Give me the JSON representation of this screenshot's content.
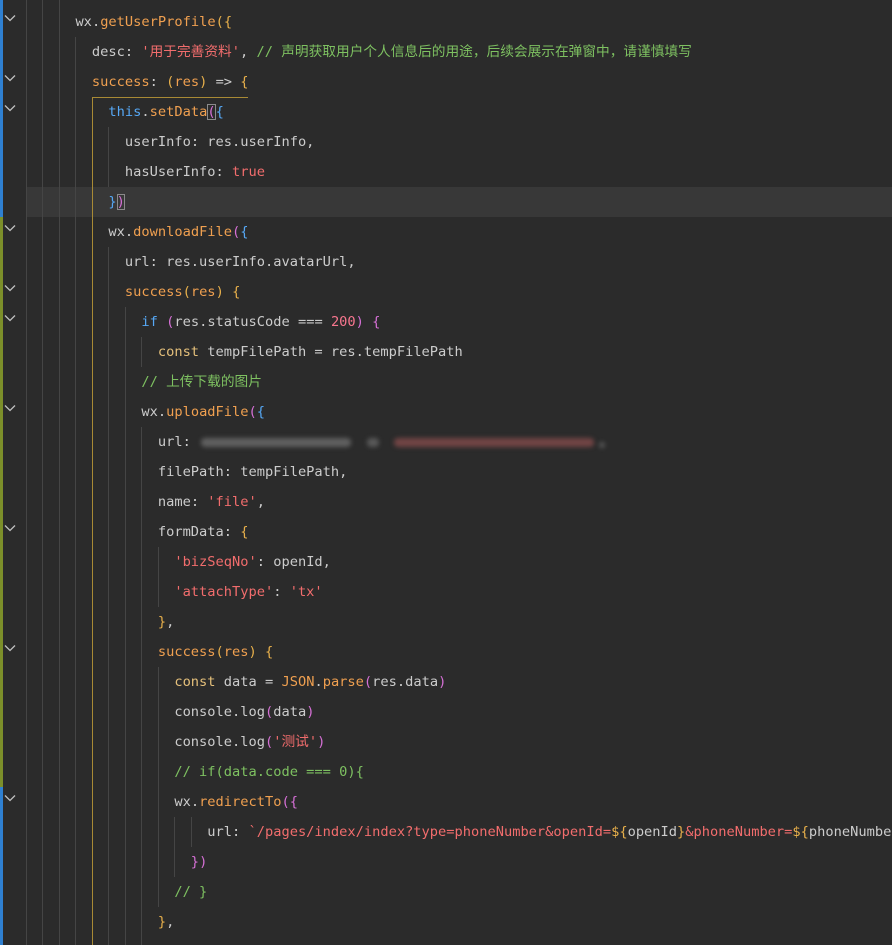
{
  "theme": {
    "background": "#2b2b2b",
    "current_line": "#383838",
    "indent_guide": "#454545",
    "active_guide": "#a88a35",
    "fold_icon": "#c0c0c0",
    "bracket_box": "#8a8a8a"
  },
  "editor": {
    "lines": [
      {
        "foldable": true,
        "change": "#2f80d1",
        "tokens": [
          [
            "      wx",
            "#cccccc"
          ],
          [
            ".",
            "#cccccc"
          ],
          [
            "getUserProfile",
            "#f0a050"
          ],
          [
            "(",
            "#e8b04b"
          ],
          [
            "{",
            "#e8b04b"
          ]
        ]
      },
      {
        "change": "#2f80d1",
        "tokens": [
          [
            "        desc",
            "#cccccc"
          ],
          [
            ": ",
            "#cccccc"
          ],
          [
            "'用于完善资料'",
            "#f26d6d"
          ],
          [
            ", ",
            "#cccccc"
          ],
          [
            "// 声明获取用户个人信息后的用途，后续会展示在弹窗中，请谨慎填写",
            "#7ec161"
          ]
        ]
      },
      {
        "foldable": true,
        "scope_open": true,
        "change": "#2f80d1",
        "tokens": [
          [
            "        success",
            "#f0a050"
          ],
          [
            ": ",
            "#cccccc"
          ],
          [
            "(",
            "#e8b04b"
          ],
          [
            "res",
            "#f0a050"
          ],
          [
            ")",
            "#e8b04b"
          ],
          [
            " => ",
            "#cccccc"
          ],
          [
            "{",
            "#e8b04b"
          ]
        ]
      },
      {
        "foldable": true,
        "change": "#2f80d1",
        "tokens": [
          [
            "          this",
            "#56a8f5"
          ],
          [
            ".",
            "#cccccc"
          ],
          [
            "setData",
            "#f0a050"
          ],
          [
            "(",
            "#d670d6",
            true
          ],
          [
            "{",
            "#56a8f5"
          ]
        ]
      },
      {
        "change": "#2f80d1",
        "tokens": [
          [
            "            userInfo",
            "#cccccc"
          ],
          [
            ": res.userInfo,",
            "#cccccc"
          ]
        ]
      },
      {
        "change": "#2f80d1",
        "tokens": [
          [
            "            hasUserInfo",
            "#cccccc"
          ],
          [
            ": ",
            "#cccccc"
          ],
          [
            "true",
            "#f26d6d"
          ]
        ]
      },
      {
        "current": true,
        "change": "#2f80d1",
        "tokens": [
          [
            "          }",
            "#56a8f5"
          ],
          [
            ")",
            "#d670d6",
            true
          ]
        ]
      },
      {
        "foldable": true,
        "change": "#7c8f2a",
        "tokens": [
          [
            "          wx",
            "#cccccc"
          ],
          [
            ".",
            "#cccccc"
          ],
          [
            "downloadFile",
            "#f0a050"
          ],
          [
            "(",
            "#d670d6"
          ],
          [
            "{",
            "#56a8f5"
          ]
        ]
      },
      {
        "change": "#7c8f2a",
        "tokens": [
          [
            "            url",
            "#cccccc"
          ],
          [
            ": res.userInfo.avatarUrl,",
            "#cccccc"
          ]
        ]
      },
      {
        "foldable": true,
        "change": "#7c8f2a",
        "tokens": [
          [
            "            success",
            "#f0a050"
          ],
          [
            "(",
            "#e8b04b"
          ],
          [
            "res",
            "#f0a050"
          ],
          [
            ")",
            "#e8b04b"
          ],
          [
            " ",
            "#cccccc"
          ],
          [
            "{",
            "#e8b04b"
          ]
        ]
      },
      {
        "foldable": true,
        "change": "#7c8f2a",
        "tokens": [
          [
            "              if",
            "#56a8f5"
          ],
          [
            " ",
            "#cccccc"
          ],
          [
            "(",
            "#d670d6"
          ],
          [
            "res.statusCode === ",
            "#cccccc"
          ],
          [
            "200",
            "#f7768e"
          ],
          [
            ")",
            "#d670d6"
          ],
          [
            " ",
            "#cccccc"
          ],
          [
            "{",
            "#d670d6"
          ]
        ]
      },
      {
        "change": "#7c8f2a",
        "tokens": [
          [
            "                const",
            "#e5c07b"
          ],
          [
            " tempFilePath = res.tempFilePath",
            "#cccccc"
          ]
        ]
      },
      {
        "change": "#7c8f2a",
        "tokens": [
          [
            "              // 上传下载的图片",
            "#7ec161"
          ]
        ]
      },
      {
        "foldable": true,
        "change": "#7c8f2a",
        "tokens": [
          [
            "              wx",
            "#cccccc"
          ],
          [
            ".",
            "#cccccc"
          ],
          [
            "uploadFile",
            "#f0a050"
          ],
          [
            "(",
            "#d670d6"
          ],
          [
            "{",
            "#56a8f5"
          ]
        ]
      },
      {
        "change": "#7c8f2a",
        "tokens": [
          [
            "                url",
            "#cccccc"
          ],
          [
            ": ",
            "#cccccc"
          ],
          {
            "redacted": true
          }
        ]
      },
      {
        "change": "#7c8f2a",
        "tokens": [
          [
            "                filePath",
            "#cccccc"
          ],
          [
            ": tempFilePath,",
            "#cccccc"
          ]
        ]
      },
      {
        "change": "#7c8f2a",
        "tokens": [
          [
            "                name",
            "#cccccc"
          ],
          [
            ": ",
            "#cccccc"
          ],
          [
            "'file'",
            "#f26d6d"
          ],
          [
            ",",
            "#cccccc"
          ]
        ]
      },
      {
        "foldable": true,
        "change": "#7c8f2a",
        "tokens": [
          [
            "                formData",
            "#cccccc"
          ],
          [
            ": ",
            "#cccccc"
          ],
          [
            "{",
            "#e8b04b"
          ]
        ]
      },
      {
        "change": "#7c8f2a",
        "tokens": [
          [
            "                  'bizSeqNo'",
            "#f26d6d"
          ],
          [
            ": openId,",
            "#cccccc"
          ]
        ]
      },
      {
        "change": "#7c8f2a",
        "tokens": [
          [
            "                  'attachType'",
            "#f26d6d"
          ],
          [
            ": ",
            "#cccccc"
          ],
          [
            "'tx'",
            "#f26d6d"
          ]
        ]
      },
      {
        "change": "#7c8f2a",
        "tokens": [
          [
            "                }",
            "#e8b04b"
          ],
          [
            ",",
            "#cccccc"
          ]
        ]
      },
      {
        "foldable": true,
        "change": "#7c8f2a",
        "tokens": [
          [
            "                success",
            "#f0a050"
          ],
          [
            "(",
            "#e8b04b"
          ],
          [
            "res",
            "#f0a050"
          ],
          [
            ")",
            "#e8b04b"
          ],
          [
            " ",
            "#cccccc"
          ],
          [
            "{",
            "#e8b04b"
          ]
        ]
      },
      {
        "change": "#7c8f2a",
        "tokens": [
          [
            "                  const",
            "#e5c07b"
          ],
          [
            " data = ",
            "#cccccc"
          ],
          [
            "JSON",
            "#f0a050"
          ],
          [
            ".",
            "#cccccc"
          ],
          [
            "parse",
            "#f0a050"
          ],
          [
            "(",
            "#d670d6"
          ],
          [
            "res.data",
            "#cccccc"
          ],
          [
            ")",
            "#d670d6"
          ]
        ]
      },
      {
        "change": "#7c8f2a",
        "tokens": [
          [
            "                  console.log",
            "#cccccc"
          ],
          [
            "(",
            "#d670d6"
          ],
          [
            "data",
            "#cccccc"
          ],
          [
            ")",
            "#d670d6"
          ]
        ]
      },
      {
        "change": "#7c8f2a",
        "tokens": [
          [
            "                  console.log",
            "#cccccc"
          ],
          [
            "(",
            "#d670d6"
          ],
          [
            "'测试'",
            "#f26d6d"
          ],
          [
            ")",
            "#d670d6"
          ]
        ]
      },
      {
        "change": "#7c8f2a",
        "tokens": [
          [
            "                  // if(data.code === 0){",
            "#7ec161"
          ]
        ]
      },
      {
        "foldable": true,
        "change": "#2f80d1",
        "tokens": [
          [
            "                  wx",
            "#cccccc"
          ],
          [
            ".",
            "#cccccc"
          ],
          [
            "redirectTo",
            "#f0a050"
          ],
          [
            "(",
            "#d670d6"
          ],
          [
            "{",
            "#d670d6"
          ]
        ]
      },
      {
        "change": "#2f80d1",
        "tokens": [
          [
            "                      url",
            "#cccccc"
          ],
          [
            ": ",
            "#cccccc"
          ],
          [
            "`/pages/index/index?type=phoneNumber&openId=",
            "#f26d6d"
          ],
          [
            "${",
            "#e8b04b"
          ],
          [
            "openId",
            "#cccccc"
          ],
          [
            "}",
            "#e8b04b"
          ],
          [
            "&phoneNumber=",
            "#f26d6d"
          ],
          [
            "${",
            "#e8b04b"
          ],
          [
            "phoneNumbe",
            "#cccccc"
          ]
        ]
      },
      {
        "change": "#2f80d1",
        "tokens": [
          [
            "                    }",
            "#d670d6"
          ],
          [
            ")",
            "#d670d6"
          ]
        ]
      },
      {
        "change": "#2f80d1",
        "tokens": [
          [
            "                  // }",
            "#7ec161"
          ]
        ]
      },
      {
        "change": "#2f80d1",
        "tokens": [
          [
            "                }",
            "#e8b04b"
          ],
          [
            ",",
            "#cccccc"
          ]
        ]
      }
    ]
  }
}
